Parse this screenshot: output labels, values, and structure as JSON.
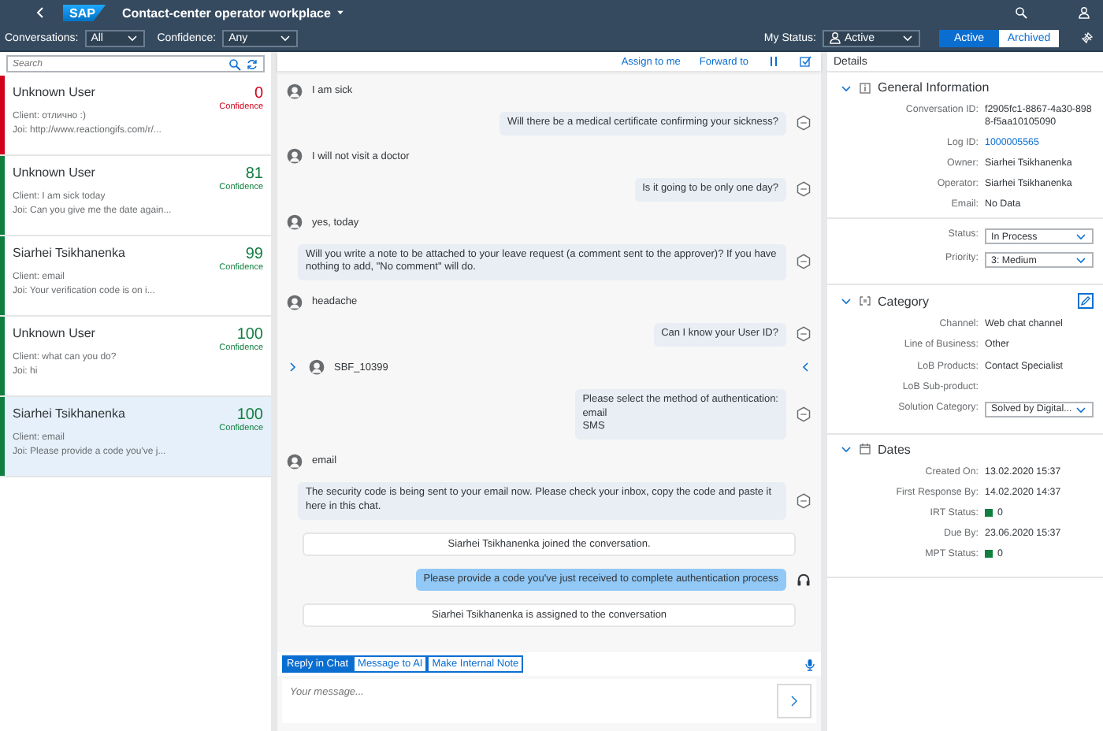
{
  "shell": {
    "logo": "SAP",
    "title": "Contact-center operator workplace"
  },
  "filters": [
    {
      "label": "Conversations:",
      "value": "All"
    },
    {
      "label": "Confidence:",
      "value": "Any"
    }
  ],
  "my_status": {
    "label": "My Status:",
    "value": "Active"
  },
  "view_toggle": [
    {
      "label": "Active",
      "selected": true
    },
    {
      "label": "Archived",
      "selected": false
    }
  ],
  "search": {
    "placeholder": "Search"
  },
  "conversations": [
    {
      "name": "Unknown User",
      "score": "0",
      "score_label": "Confidence",
      "client": "Client: отлично :)",
      "joi": "Joi: http://www.reactiongifs.com/r/...",
      "color": "#d0021b",
      "selected": false
    },
    {
      "name": "Unknown User",
      "score": "81",
      "score_label": "Confidence",
      "client": "Client: I am sick today",
      "joi": "Joi: Can you give me the date again...",
      "color": "#107e3e",
      "selected": false
    },
    {
      "name": "Siarhei Tsikhanenka",
      "score": "99",
      "score_label": "Confidence",
      "client": "Client: email",
      "joi": "Joi: Your verification code is on i...",
      "color": "#107e3e",
      "selected": false
    },
    {
      "name": "Unknown User",
      "score": "100",
      "score_label": "Confidence",
      "client": "Client: what can you do?",
      "joi": "Joi: hi",
      "color": "#107e3e",
      "selected": false
    },
    {
      "name": "Siarhei Tsikhanenka",
      "score": "100",
      "score_label": "Confidence",
      "client": "Client: email",
      "joi": "Joi: Please provide a code you've j...",
      "color": "#107e3e",
      "selected": true
    }
  ],
  "chat_actions": [
    "Assign to me",
    "Forward to"
  ],
  "messages": [
    {
      "kind": "user",
      "text": "I am sick"
    },
    {
      "kind": "bot",
      "text": "Will there be a medical certificate confirming your sickness?"
    },
    {
      "kind": "user",
      "text": "I will not visit a doctor"
    },
    {
      "kind": "bot",
      "text": "Is it going to be only one day?"
    },
    {
      "kind": "user",
      "text": "yes, today"
    },
    {
      "kind": "bot",
      "text": "Will you write a note to be attached to your leave request (a comment sent to the approver)? If you have nothing to add, \"No comment\" will do."
    },
    {
      "kind": "user",
      "text": "headache"
    },
    {
      "kind": "bot",
      "text": "Can I know your User ID?"
    },
    {
      "kind": "user",
      "text": "SBF_10399"
    },
    {
      "kind": "bot",
      "text": "Please select the method of authentication:\nemail\nSMS"
    },
    {
      "kind": "user",
      "text": "email"
    },
    {
      "kind": "bot",
      "text": "The security code is being sent to your email now. Please check your inbox, copy the code and paste it here in this chat."
    },
    {
      "kind": "system",
      "text": "Siarhei Tsikhanenka joined the conversation."
    },
    {
      "kind": "agent",
      "text": "Please provide a code you've just received to complete authentication process"
    },
    {
      "kind": "system",
      "text": "Siarhei Tsikhanenka is assigned to the conversation"
    }
  ],
  "reply_tabs": [
    {
      "label": "Reply in Chat",
      "selected": true
    },
    {
      "label": "Message to AI",
      "selected": false
    },
    {
      "label": "Make Internal Note",
      "selected": false
    }
  ],
  "composer": {
    "placeholder": "Your message..."
  },
  "details": {
    "title": "Details",
    "sections": [
      {
        "kind": "info",
        "title": "General Information",
        "expanded": true,
        "groups": [
          [
            {
              "kind": "text",
              "label": "Conversation ID:",
              "value": "f2905fc1-8867-4a30-8988-f5aa10105090"
            },
            {
              "kind": "link",
              "label": "Log ID:",
              "value": "1000005565"
            },
            {
              "kind": "text",
              "label": "Owner:",
              "value": "Siarhei Tsikhanenka"
            },
            {
              "kind": "text",
              "label": "Operator:",
              "value": "Siarhei Tsikhanenka"
            },
            {
              "kind": "text",
              "label": "Email:",
              "value": "No Data"
            }
          ],
          [
            {
              "kind": "select",
              "label": "Status:",
              "value": "In Process"
            },
            {
              "kind": "select",
              "label": "Priority:",
              "value": "3: Medium"
            }
          ]
        ]
      },
      {
        "kind": "category",
        "title": "Category",
        "expanded": true,
        "groups": [
          [
            {
              "kind": "text",
              "label": "Channel:",
              "value": "Web chat channel"
            },
            {
              "kind": "text",
              "label": "Line of Business:",
              "value": "Other"
            },
            {
              "kind": "text",
              "label": "LoB Products:",
              "value": "Contact Specialist"
            },
            {
              "kind": "text",
              "label": "LoB Sub-product:"
            },
            {
              "kind": "select",
              "label": "Solution Category:",
              "value": "Solved by Digital..."
            }
          ]
        ]
      },
      {
        "kind": "dates",
        "title": "Dates",
        "expanded": true,
        "groups": [
          [
            {
              "kind": "text",
              "label": "Created On:",
              "value": "13.02.2020 15:37"
            },
            {
              "kind": "text",
              "label": "First Response By:",
              "value": "14.02.2020 14:37"
            },
            {
              "kind": "status",
              "label": "IRT Status:",
              "value": "0",
              "color": "#107e3e"
            },
            {
              "kind": "text",
              "label": "Due By:",
              "value": "23.06.2020 15:37"
            },
            {
              "kind": "status",
              "label": "MPT Status:",
              "value": "0",
              "color": "#107e3e"
            }
          ]
        ]
      }
    ]
  }
}
